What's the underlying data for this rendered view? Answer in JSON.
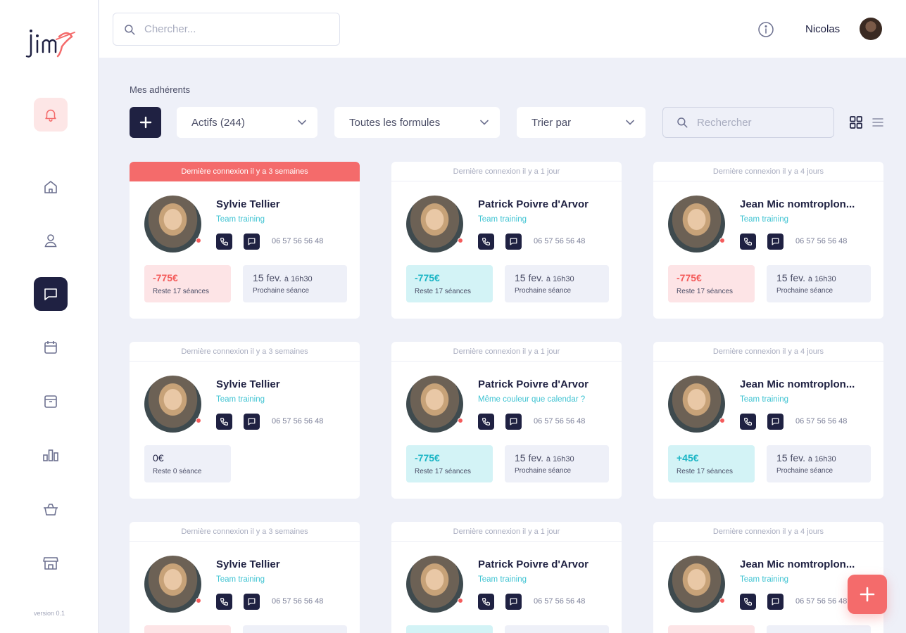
{
  "app": {
    "logo_text": "jim"
  },
  "sidebar": {
    "items": [
      {
        "icon": "bell-icon",
        "name": "sidebar-item-notifications"
      },
      {
        "icon": "home-icon",
        "name": "sidebar-item-home"
      },
      {
        "icon": "user-icon",
        "name": "sidebar-item-members"
      },
      {
        "icon": "chat-icon",
        "name": "sidebar-item-messages",
        "active": true
      },
      {
        "icon": "calendar-icon",
        "name": "sidebar-item-calendar"
      },
      {
        "icon": "archive-icon",
        "name": "sidebar-item-archive"
      },
      {
        "icon": "bar-chart-icon",
        "name": "sidebar-item-stats"
      },
      {
        "icon": "basket-icon",
        "name": "sidebar-item-shop"
      },
      {
        "icon": "store-icon",
        "name": "sidebar-item-store"
      }
    ],
    "version": "version 0.1"
  },
  "header": {
    "search_placeholder": "Chercher...",
    "user_name": "Nicolas"
  },
  "toolbar": {
    "section_title": "Mes adhérents",
    "filter_status": "Actifs (244)",
    "filter_formula": "Toutes les formules",
    "sort_label": "Trier par",
    "search_placeholder": "Rechercher"
  },
  "colors": {
    "navy": "#1f2142",
    "alert": "#f46b6b",
    "teal": "#3fc3d2",
    "background": "#eef0f8"
  },
  "cards": [
    {
      "banner": "Dernière connexion il y a 3 semaines",
      "alert": true,
      "name": "Sylvie Tellier",
      "sub": "Team training",
      "phone": "06 57 56 56 48",
      "amount": "-775€",
      "remaining": "Reste 17 séances",
      "kind": "neg",
      "date": "15 fev.",
      "time": "à 16h30",
      "next_label": "Prochaine séance"
    },
    {
      "banner": "Dernière connexion il y a 1 jour",
      "alert": false,
      "name": "Patrick Poivre d'Arvor",
      "sub": "Team training",
      "phone": "06 57 56 56 48",
      "amount": "-775€",
      "remaining": "Reste 17 séances",
      "kind": "pos",
      "date": "15 fev.",
      "time": "à 16h30",
      "next_label": "Prochaine séance"
    },
    {
      "banner": "Dernière connexion il y a 4 jours",
      "alert": false,
      "name": "Jean Mic nomtroplon...",
      "sub": "Team training",
      "phone": "06 57 56 56 48",
      "amount": "-775€",
      "remaining": "Reste 17 séances",
      "kind": "neg",
      "date": "15 fev.",
      "time": "à 16h30",
      "next_label": "Prochaine séance"
    },
    {
      "banner": "Dernière connexion il y a 3 semaines",
      "alert": false,
      "name": "Sylvie Tellier",
      "sub": "Team training",
      "phone": "06 57 56 56 48",
      "amount": "0€",
      "remaining": "Reste 0 séance",
      "kind": "zero",
      "date": "",
      "time": "",
      "next_label": ""
    },
    {
      "banner": "Dernière connexion il y a 1 jour",
      "alert": false,
      "name": "Patrick Poivre d'Arvor",
      "sub": "Même couleur que calendar ?",
      "phone": "06 57 56 56 48",
      "amount": "-775€",
      "remaining": "Reste 17 séances",
      "kind": "pos",
      "date": "15 fev.",
      "time": "à 16h30",
      "next_label": "Prochaine séance"
    },
    {
      "banner": "Dernière connexion il y a 4 jours",
      "alert": false,
      "name": "Jean Mic nomtroplon...",
      "sub": "Team training",
      "phone": "06 57 56 56 48",
      "amount": "+45€",
      "remaining": "Reste 17 séances",
      "kind": "pos",
      "date": "15 fev.",
      "time": "à 16h30",
      "next_label": "Prochaine séance"
    },
    {
      "banner": "Dernière connexion il y a 3 semaines",
      "alert": false,
      "name": "Sylvie Tellier",
      "sub": "Team training",
      "phone": "06 57 56 56 48",
      "amount": "",
      "remaining": "",
      "kind": "neg",
      "date": "",
      "time": "",
      "next_label": ""
    },
    {
      "banner": "Dernière connexion il y a 1 jour",
      "alert": false,
      "name": "Patrick Poivre d'Arvor",
      "sub": "Team training",
      "phone": "06 57 56 56 48",
      "amount": "",
      "remaining": "",
      "kind": "pos",
      "date": "",
      "time": "",
      "next_label": ""
    },
    {
      "banner": "Dernière connexion il y a 4 jours",
      "alert": false,
      "name": "Jean Mic nomtroplon...",
      "sub": "Team training",
      "phone": "06 57 56 56 48",
      "amount": "",
      "remaining": "",
      "kind": "neg",
      "date": "",
      "time": "",
      "next_label": ""
    }
  ]
}
